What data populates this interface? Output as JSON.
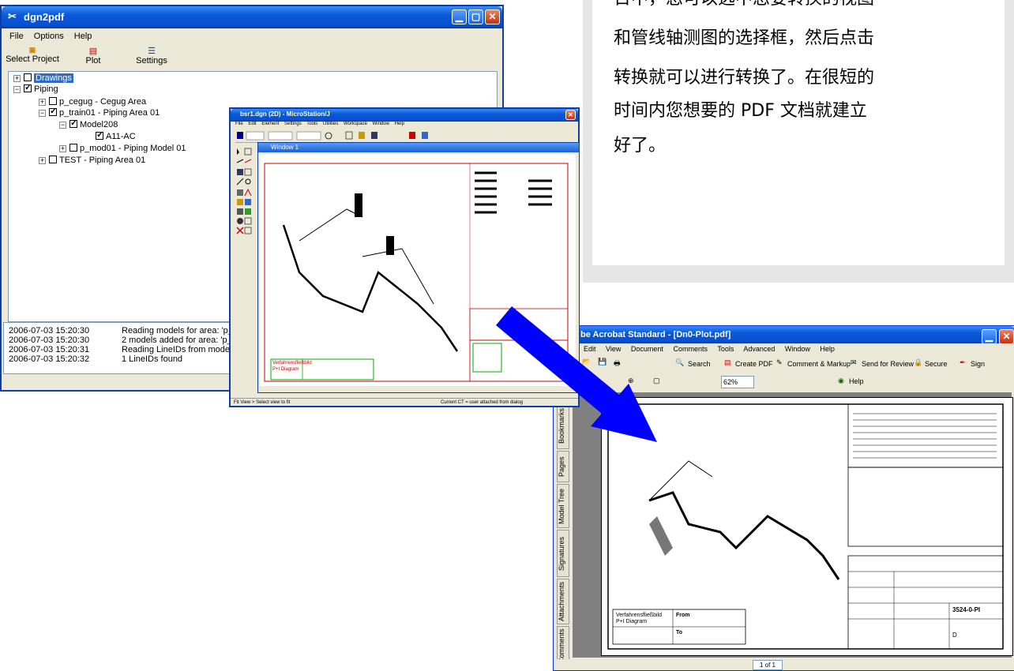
{
  "text_panel": {
    "lines": [
      "日中，您可以选中您要转换的视图",
      "和管线轴测图的选择框，然后点击",
      "转换就可以进行转换了。在很短的",
      "时间内您想要的 PDF 文档就建立",
      "好了。"
    ]
  },
  "dgn2pdf": {
    "title": "dgn2pdf",
    "menu": [
      "File",
      "Options",
      "Help"
    ],
    "toolbar": {
      "select_project": "Select Project",
      "plot": "Plot",
      "settings": "Settings"
    },
    "tree": {
      "drawings": "Drawings",
      "piping": "Piping",
      "cegug": "p_cegug - Cegug Area",
      "train01": "p_train01 - Piping Area 01",
      "model208": "Model208",
      "a11": "A11-AC",
      "mod01": "p_mod01 - Piping Model 01",
      "test": "TEST - Piping Area 01"
    },
    "log": [
      {
        "time": "2006-07-03 15:20:30",
        "msg": "Reading models for area: 'p_trai"
      },
      {
        "time": "2006-07-03 15:20:30",
        "msg": "2 models added for area: 'p_train"
      },
      {
        "time": "2006-07-03 15:20:31",
        "msg": "Reading LineIDs from model: 'Mo"
      },
      {
        "time": "2006-07-03 15:20:32",
        "msg": "1 LineIDs found"
      }
    ]
  },
  "microstation": {
    "title": "bsr1.dgn (2D) - MicroStation/J",
    "menu": [
      "File",
      "Edit",
      "Element",
      "Settings",
      "Tools",
      "Utilities",
      "Workspace",
      "Window",
      "Help"
    ],
    "view_title": "Window 1",
    "status_left": "Fit View > Select view to fit",
    "status_right": "Current CT = user attached from dialog",
    "title_block": {
      "line1": "Verfahrensfließbild",
      "line2": "P+I Diagram"
    }
  },
  "acrobat": {
    "title": "be Acrobat Standard - [Dn0-Plot.pdf]",
    "menu": [
      "Edit",
      "View",
      "Document",
      "Comments",
      "Tools",
      "Advanced",
      "Window",
      "Help"
    ],
    "toolbar": {
      "search": "Search",
      "create_pdf": "Create PDF",
      "comment": "Comment & Markup",
      "review": "Send for Review",
      "secure": "Secure",
      "sign": "Sign",
      "zoom": "62%",
      "help": "Help"
    },
    "side_tabs": [
      "Bookmarks",
      "Pages",
      "Model Tree",
      "Signatures",
      "Attachments",
      "Comments"
    ],
    "page_field": "1 of 1",
    "title_block": {
      "line1": "Verfahrensfließbild",
      "line2": "P+I Diagram",
      "from": "From",
      "to": "To",
      "drawing_no": "3524-0-PI",
      "rev": "D"
    }
  }
}
